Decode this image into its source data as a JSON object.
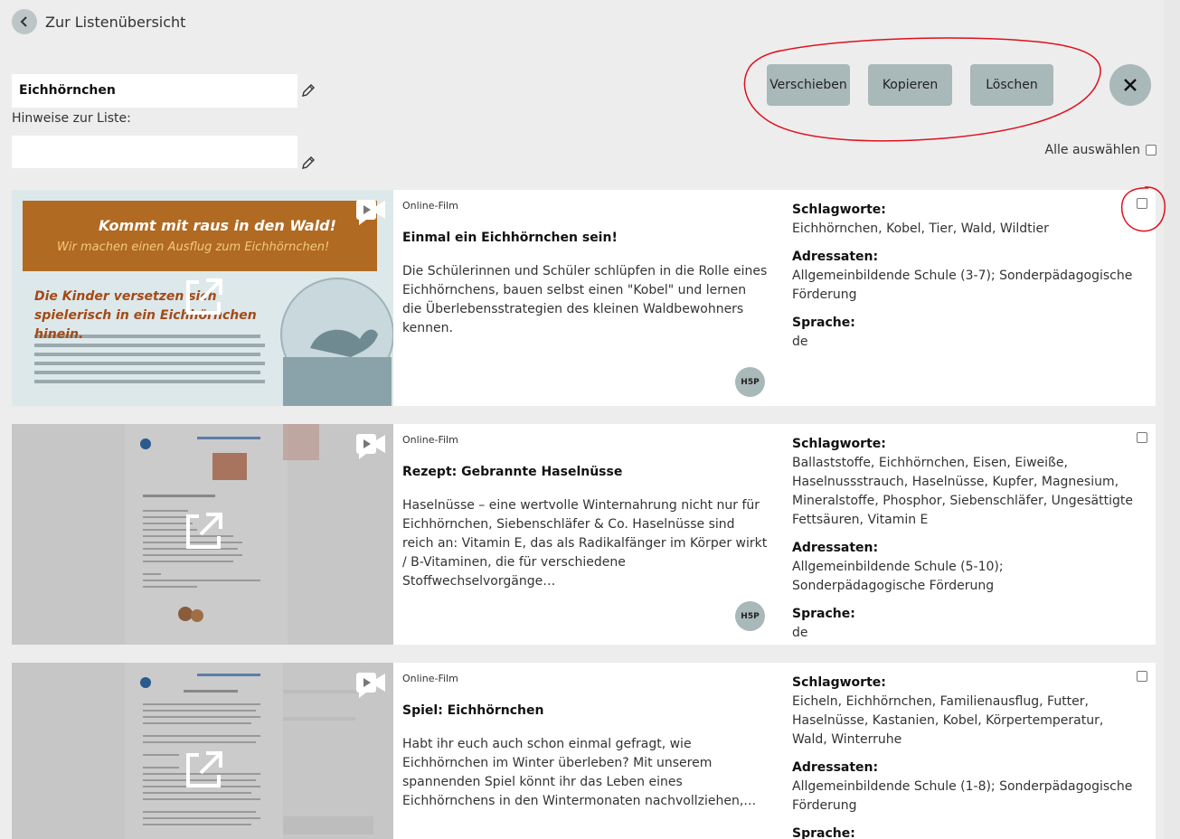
{
  "nav": {
    "back_label": "Zur Listenübersicht"
  },
  "list": {
    "name": "Eichhörnchen",
    "notes_label": "Hinweise zur Liste:",
    "notes_value": ""
  },
  "toolbar": {
    "move_label": "Verschieben",
    "copy_label": "Kopieren",
    "delete_label": "Löschen"
  },
  "select_all_label": "Alle auswählen",
  "meta_labels": {
    "keywords": "Schlagworte:",
    "audience": "Adressaten:",
    "language": "Sprache:"
  },
  "items": [
    {
      "type": "Online-Film",
      "title": "Einmal ein Eichhörnchen sein!",
      "description": "Die Schülerinnen und Schüler schlüpfen in die Rolle eines Eichhörnchens, bauen selbst einen \"Kobel\" und lernen die Überlebensstrategien des kleinen Waldbewohners kennen.",
      "badge": "H5P",
      "keywords": "Eichhörnchen, Kobel, Tier, Wald, Wildtier",
      "audience": "Allgemeinbildende Schule (3-7); Sonderpädagogische Förderung",
      "language": "de",
      "thumb_text": {
        "headline": "Kommt mit raus in den Wald!",
        "subline": "Wir machen einen Ausflug zum Eichhörnchen!",
        "lead": "Die Kinder versetzen sich spielerisch in ein Eichhörnchen hinein."
      }
    },
    {
      "type": "Online-Film",
      "title": "Rezept: Gebrannte Haselnüsse",
      "description": "Haselnüsse – eine wertvolle Winternahrung nicht nur für Eichhörnchen, Siebenschläfer & Co. Haselnüsse sind reich an: Vitamin E, das als Radikalfänger im Körper wirkt / B-Vitaminen, die für verschiedene Stoffwechselvorgänge…",
      "badge": "H5P",
      "keywords": "Ballaststoffe, Eichhörnchen, Eisen, Eiweiße, Haselnussstrauch, Haselnüsse, Kupfer, Magnesium, Mineralstoffe, Phosphor, Siebenschläfer, Ungesättigte Fettsäuren, Vitamin E",
      "audience": "Allgemeinbildende Schule (5-10); Sonderpädagogische Förderung",
      "language": "de"
    },
    {
      "type": "Online-Film",
      "title": "Spiel: Eichhörnchen",
      "description": "Habt ihr euch auch schon einmal gefragt, wie Eichhörnchen im Winter überleben? Mit unserem spannenden Spiel könnt ihr das Leben eines Eichhörnchens in den Wintermonaten nachvollziehen,…",
      "keywords": "Eicheln, Eichhörnchen, Familienausflug, Futter, Haselnüsse, Kastanien, Kobel, Körpertemperatur, Wald, Winterruhe",
      "audience": "Allgemeinbildende Schule (1-8); Sonderpädagogische Förderung",
      "language": ""
    }
  ],
  "colors": {
    "button_bg": "#a9b8b8",
    "annotation_red": "#e0101e",
    "thumb_banner": "#b06a22"
  }
}
